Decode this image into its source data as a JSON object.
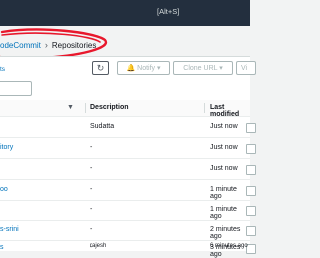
{
  "topbar": {
    "search_shortcut": "[Alt+S]"
  },
  "breadcrumb": {
    "parent": "odeCommit",
    "current": "Repositories"
  },
  "panel": {
    "title": "ts"
  },
  "toolbar": {
    "refresh_icon": "refresh-icon",
    "notify_label": "🔔 Notify ▾",
    "clone_url_label": "Clone URL ▾",
    "view_label": "Vi"
  },
  "table": {
    "headers": {
      "description": "Description",
      "last_modified": "Last modified",
      "sort_icon": "▼"
    },
    "rows": [
      {
        "name": "",
        "description": "Sudatta",
        "last_modified": "Just now"
      },
      {
        "name": "itory",
        "description": "-",
        "last_modified": "Just now"
      },
      {
        "name": "",
        "description": "-",
        "last_modified": "Just now"
      },
      {
        "name": "oo",
        "description": "-",
        "last_modified": "1 minute ago"
      },
      {
        "name": "",
        "description": "-",
        "last_modified": "1 minute ago"
      },
      {
        "name": "s-srini",
        "description": "-",
        "last_modified": "2 minutes ago"
      },
      {
        "name": "s",
        "description": "-",
        "last_modified": "3 minutes ago"
      },
      {
        "name": "",
        "description": "rajesh",
        "last_modified": "6 minutes ago"
      }
    ]
  },
  "colors": {
    "link": "#0073bb",
    "topbar": "#232f3e",
    "annotation": "#e8182c"
  }
}
